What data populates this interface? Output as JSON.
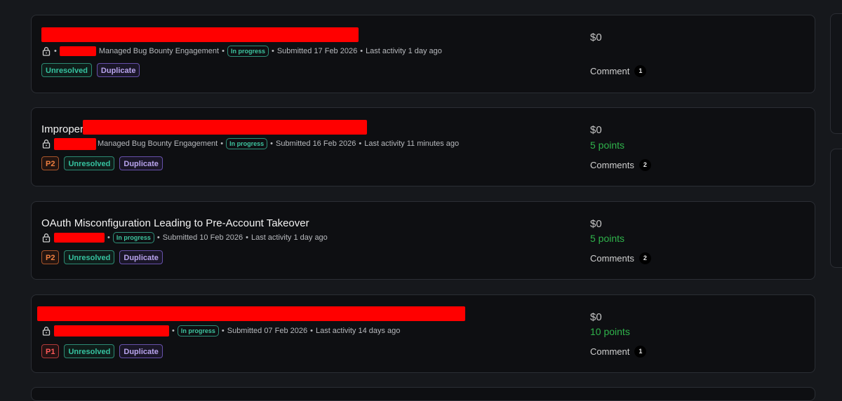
{
  "reports": [
    {
      "title": "",
      "program": "Managed Bug Bounty Engagement",
      "status": "In progress",
      "submitted": "Submitted 17 Feb 2026",
      "activity": "Last activity 1 day ago",
      "priority": "",
      "state": "Unresolved",
      "substate": "Duplicate",
      "bounty": "$0",
      "points": "",
      "comments_label": "Comment",
      "comments_count": "1"
    },
    {
      "title": "Improper",
      "program": "Managed Bug Bounty Engagement",
      "status": "In progress",
      "submitted": "Submitted 16 Feb 2026",
      "activity": "Last activity 11 minutes ago",
      "priority": "P2",
      "state": "Unresolved",
      "substate": "Duplicate",
      "bounty": "$0",
      "points": "5 points",
      "comments_label": "Comments",
      "comments_count": "2"
    },
    {
      "title": "OAuth Misconfiguration Leading to Pre-Account Takeover",
      "program": "",
      "status": "In progress",
      "submitted": "Submitted 10 Feb 2026",
      "activity": "Last activity 1 day ago",
      "priority": "P2",
      "state": "Unresolved",
      "substate": "Duplicate",
      "bounty": "$0",
      "points": "5 points",
      "comments_label": "Comments",
      "comments_count": "2"
    },
    {
      "title": "",
      "program": "",
      "status": "In progress",
      "submitted": "Submitted 07 Feb 2026",
      "activity": "Last activity 14 days ago",
      "priority": "P1",
      "state": "Unresolved",
      "substate": "Duplicate",
      "bounty": "$0",
      "points": "10 points",
      "comments_label": "Comment",
      "comments_count": "1"
    }
  ],
  "icons": {
    "lock": "lock-icon"
  },
  "colors": {
    "background": "#16181c",
    "card": "#0e0f12",
    "status": "#3ec6a0",
    "points": "#2fb34b",
    "redaction": "#ff0000"
  }
}
